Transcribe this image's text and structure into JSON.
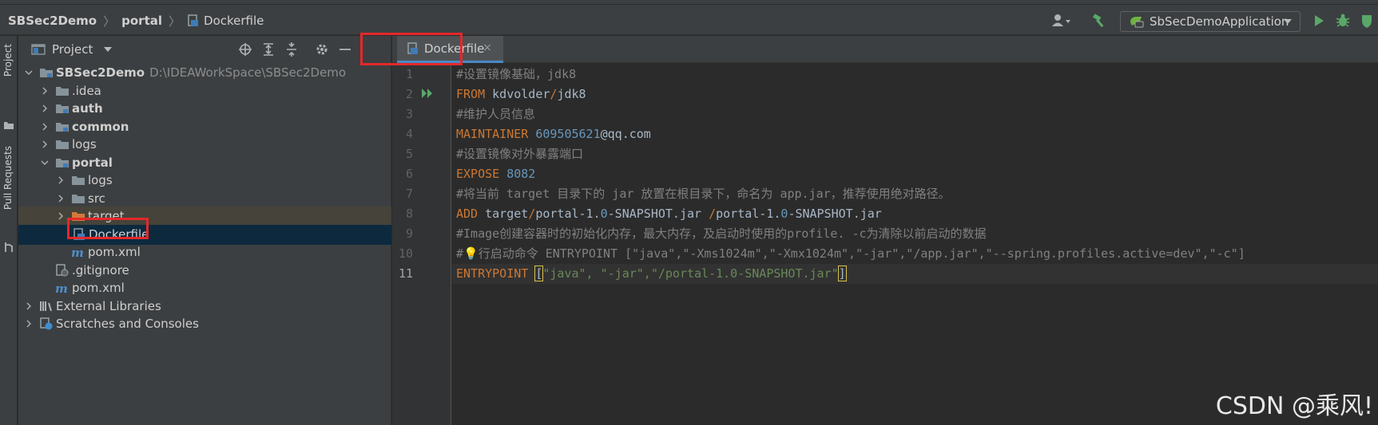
{
  "breadcrumb": {
    "project": "SBSec2Demo",
    "module": "portal",
    "file": "Dockerfile"
  },
  "run_config": {
    "label": "SbSecDemoApplication"
  },
  "stripe": {
    "project_label": "Project",
    "pull_requests_label": "Pull Requests"
  },
  "project_panel": {
    "title": "Project",
    "tree": [
      {
        "label": "SBSec2Demo",
        "path": "D:\\IDEAWorkSpace\\SBSec2Demo"
      },
      {
        "label": ".idea"
      },
      {
        "label": "auth"
      },
      {
        "label": "common"
      },
      {
        "label": "logs"
      },
      {
        "label": "portal"
      },
      {
        "label": "logs"
      },
      {
        "label": "src"
      },
      {
        "label": "target"
      },
      {
        "label": "Dockerfile"
      },
      {
        "label": "pom.xml"
      },
      {
        "label": ".gitignore"
      },
      {
        "label": "pom.xml"
      },
      {
        "label": "External Libraries"
      },
      {
        "label": "Scratches and Consoles"
      }
    ]
  },
  "editor": {
    "tab_label": "Dockerfile",
    "tab_close": "×",
    "current_line": 11,
    "lines": [
      {
        "n": "1",
        "parts": [
          {
            "t": "#设置镜像基础，jdk8",
            "c": "cm"
          }
        ]
      },
      {
        "n": "2",
        "parts": [
          {
            "t": "FROM",
            "c": "kw"
          },
          {
            "t": " kdvolder",
            "c": "txt"
          },
          {
            "t": "/",
            "c": "kw"
          },
          {
            "t": "jdk8",
            "c": "txt"
          }
        ]
      },
      {
        "n": "3",
        "parts": [
          {
            "t": "#维护人员信息",
            "c": "cm"
          }
        ]
      },
      {
        "n": "4",
        "parts": [
          {
            "t": "MAINTAINER",
            "c": "kw"
          },
          {
            "t": " 609505621",
            "c": "num"
          },
          {
            "t": "@qq.com",
            "c": "txt"
          }
        ]
      },
      {
        "n": "5",
        "parts": [
          {
            "t": "#设置镜像对外暴露端口",
            "c": "cm"
          }
        ]
      },
      {
        "n": "6",
        "parts": [
          {
            "t": "EXPOSE",
            "c": "kw"
          },
          {
            "t": " 8082",
            "c": "num"
          }
        ]
      },
      {
        "n": "7",
        "parts": [
          {
            "t": "#将当前 target 目录下的 jar 放置在根目录下，命名为 app.jar，推荐使用绝对路径。",
            "c": "cm"
          }
        ]
      },
      {
        "n": "8",
        "parts": [
          {
            "t": "ADD",
            "c": "kw"
          },
          {
            "t": " target",
            "c": "txt"
          },
          {
            "t": "/",
            "c": "kw"
          },
          {
            "t": "portal-1.",
            "c": "txt"
          },
          {
            "t": "0",
            "c": "num"
          },
          {
            "t": "-SNAPSHOT.jar ",
            "c": "txt"
          },
          {
            "t": "/",
            "c": "kw"
          },
          {
            "t": "portal-1.",
            "c": "txt"
          },
          {
            "t": "0",
            "c": "num"
          },
          {
            "t": "-SNAPSHOT.jar",
            "c": "txt"
          }
        ]
      },
      {
        "n": "9",
        "parts": [
          {
            "t": "#Image创建容器时的初始化内存，最大内存，及启动时使用的profile. -c为清除以前启动的数据",
            "c": "cm"
          }
        ]
      },
      {
        "n": "10",
        "parts": [
          {
            "t": "#",
            "c": "cm"
          },
          {
            "t": "💡",
            "c": "cm"
          },
          {
            "t": "行启动命令 ENTRYPOINT [\"java\",\"-Xms1024m\",\"-Xmx1024m\",\"-jar\",\"/app.jar\",\"--spring.profiles.active=dev\",\"-c\"]",
            "c": "cm"
          }
        ]
      },
      {
        "n": "11",
        "parts": [
          {
            "t": "ENTRYPOINT",
            "c": "kw"
          },
          {
            "t": " ",
            "c": "txt"
          },
          {
            "t": "[",
            "c": "brk"
          },
          {
            "t": "\"java\", \"-jar\",\"/portal-1.0-SNAPSHOT.jar\"",
            "c": "str"
          },
          {
            "t": "]",
            "c": "brk"
          }
        ]
      }
    ]
  },
  "watermark": "CSDN @乘风!"
}
